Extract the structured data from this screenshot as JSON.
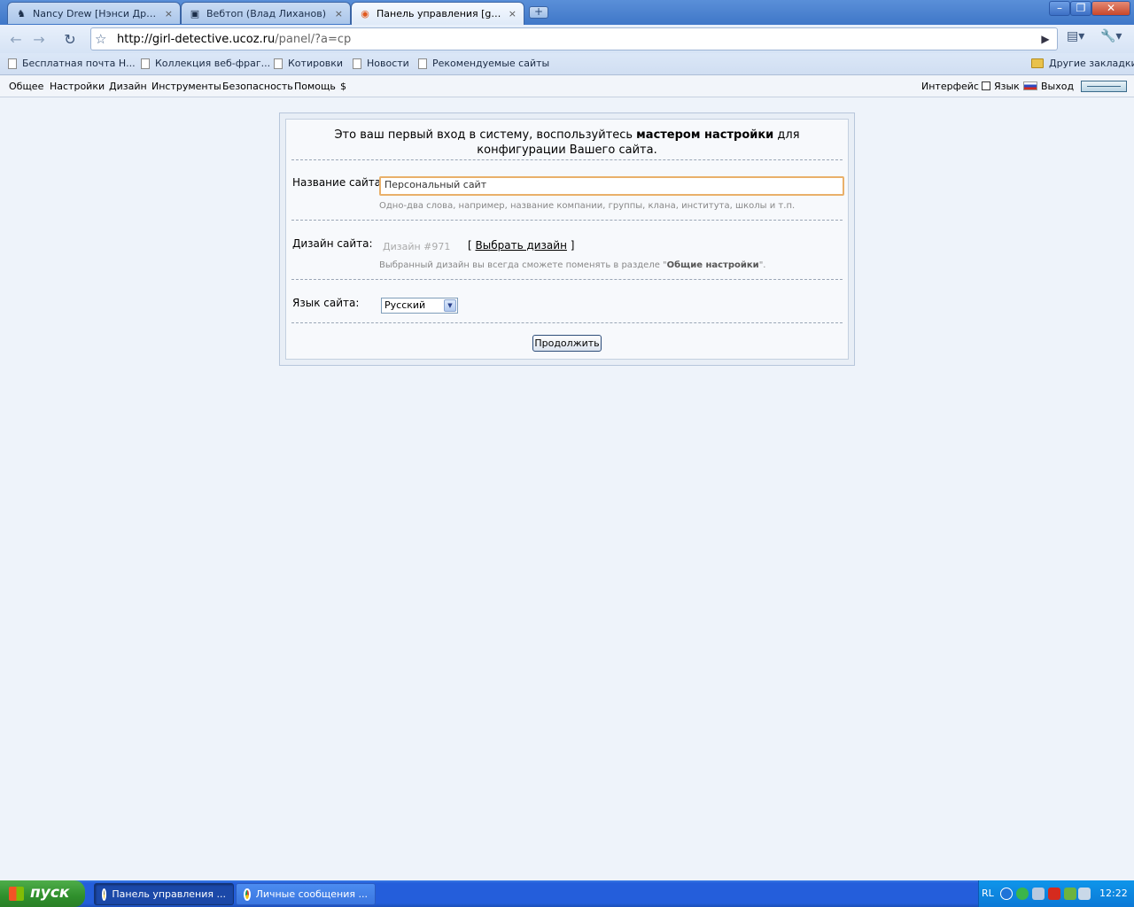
{
  "tabs": [
    {
      "title": "Nancy Drew [Нэнси Дрю] ...",
      "close": "×"
    },
    {
      "title": "Вебтоп (Влад Лиханов)",
      "close": "×"
    },
    {
      "title": "Панель управления [girl-d...",
      "close": "×"
    }
  ],
  "toolbar": {
    "url_host": "http://girl-detective.ucoz.ru",
    "url_path": "/panel/?a=cp"
  },
  "bookmarks": {
    "items": [
      "Бесплатная почта Н...",
      "Коллекция веб-фраг...",
      "Котировки",
      "Новости",
      "Рекомендуемые сайты"
    ],
    "other": "Другие закладки"
  },
  "panel_menu": {
    "items": [
      "Общее",
      "Настройки",
      "Дизайн",
      "Инструменты",
      "Безопасность",
      "Помощь",
      "$"
    ],
    "interface": "Интерфейс",
    "language": "Язык",
    "logout": "Выход"
  },
  "wizard": {
    "intro_before": "Это ваш первый вход в систему, воспользуйтесь ",
    "intro_bold": "мастером настройки",
    "intro_after": " для конфигурации Вашего сайта.",
    "site_name_label": "Название сайта:",
    "site_name_value": "Персональный сайт",
    "site_name_hint": "Одно-два слова, например, название компании, группы, клана, института, школы и т.п.",
    "design_label": "Дизайн сайта:",
    "design_value": "Дизайн #971",
    "design_link_open": "[ ",
    "design_link": "Выбрать дизайн",
    "design_link_close": " ]",
    "design_hint_before": "Выбранный дизайн вы всегда сможете поменять в разделе \"",
    "design_hint_bold": "Общие настройки",
    "design_hint_after": "\".",
    "language_label": "Язык сайта:",
    "language_value": "Русский",
    "continue_label": "Продолжить"
  },
  "taskbar": {
    "start_label": "пуск",
    "tasks": [
      "Панель управления ...",
      "Личные сообщения ..."
    ],
    "lang": "RL",
    "clock": "12:22"
  }
}
